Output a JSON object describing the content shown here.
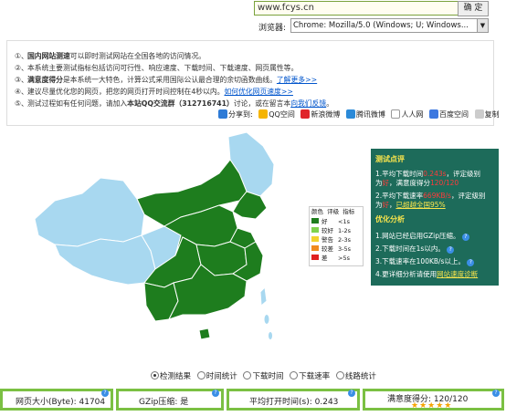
{
  "url_bar": {
    "value": "www.fcys.cn",
    "go_label": "确 定"
  },
  "browser": {
    "label": "浏览器:",
    "selected": "Chrome: Mozilla/5.0 (Windows; U; Windows..."
  },
  "info": {
    "lines": [
      {
        "num": "①、",
        "bold": "国内网站测速",
        "text": "可以即时测试网站在全国各地的访问情况。"
      },
      {
        "num": "②、",
        "text": "本系统主要测试指标包括访问可行性、响应速度、下载时间、下载速度、网页属性等。"
      },
      {
        "num": "③、",
        "bold": "满意度得分",
        "text": "是本系统一大特色，计算公式采用国际公认最合理的余切函数曲线。",
        "link": "了解更多>>"
      },
      {
        "num": "④、",
        "text": "建议尽量优化您的网页，把您的网页打开时间控制在4秒以内。",
        "link": "如何优化网页速度>>"
      },
      {
        "num": "⑤、",
        "text": "测试过程如有任何问题，请加入",
        "bold": "本站QQ交流群（312716741）",
        "text2": "讨论，或在留言本",
        "link": "向我们反馈",
        "tail": "。"
      }
    ]
  },
  "share": {
    "label": "分享到:",
    "items": [
      "QQ空间",
      "新浪微博",
      "腾讯微博",
      "人人网",
      "百度空间",
      "复制"
    ]
  },
  "legend": {
    "headers": [
      "颜色",
      "评级",
      "指标"
    ],
    "rows": [
      {
        "grade": "好",
        "range": "<1s",
        "color": "#1e7d1e"
      },
      {
        "grade": "较好",
        "range": "1-2s",
        "color": "#7fd34e"
      },
      {
        "grade": "警告",
        "range": "2-3s",
        "color": "#f2d22e"
      },
      {
        "grade": "较差",
        "range": "3-5s",
        "color": "#f08a1e"
      },
      {
        "grade": "差",
        "range": ">5s",
        "color": "#e02020"
      }
    ]
  },
  "review": {
    "title": "测试点评",
    "l1a": "1.平均下载时间",
    "l1v": "0.243s",
    "l1b": "，评定级别",
    "l1c": "为",
    "l1d": "好",
    "l1e": "，满意度得分",
    "l1f": "120/120",
    "l2a": "2.平均下载速率",
    "l2v": "669KB/s",
    "l2b": "，评定级别",
    "l2c": "为",
    "l2d": "好",
    "l2e": "，",
    "l2link": "已超越全国95%",
    "opt_title": "优化分析",
    "o1": "1.网站已经启用GZip压缩。",
    "o2": "2.下载时间在1s以内。",
    "o3": "3.下载速率在100KB/s以上。",
    "o4a": "4.更详细分析请使用",
    "o4link": "网站速度诊断"
  },
  "radios": [
    "检测结果",
    "时间统计",
    "下载时间",
    "下载速率",
    "线路统计"
  ],
  "stats": {
    "page_size_label": "网页大小(Byte):",
    "page_size_value": "41704",
    "gzip_label": "GZip压缩:",
    "gzip_value": "是",
    "avg_time_label": "平均打开时间(s):",
    "avg_time_value": "0.243",
    "score_label": "满意度得分:",
    "score_value": "120/120",
    "stars": 5
  },
  "colors": {
    "good": "#1e7d1e",
    "light": "#a8d8f0",
    "panel": "#1d6b5a",
    "border": "#7bc043"
  }
}
